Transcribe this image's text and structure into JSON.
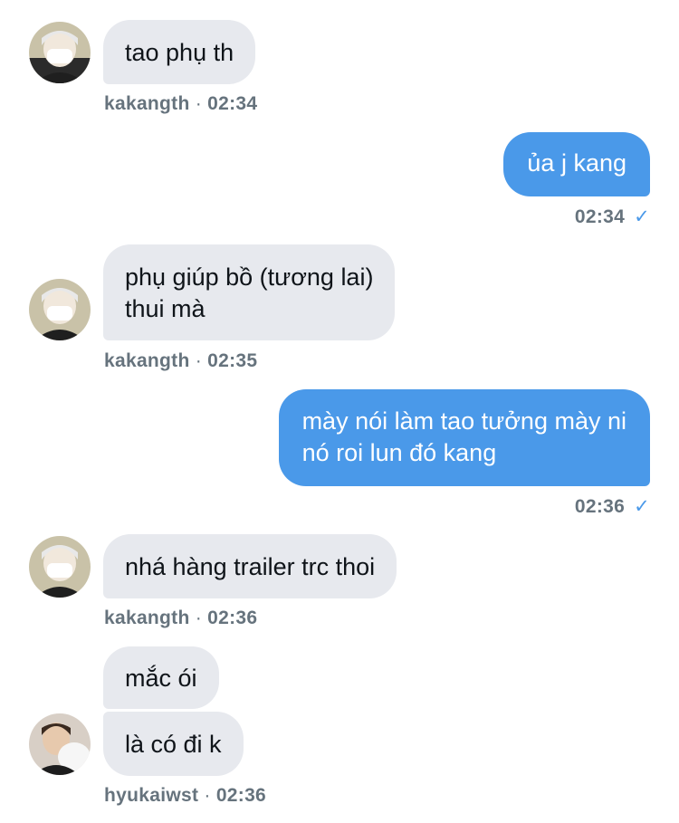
{
  "messages": [
    {
      "text": "tao phụ th",
      "sender": "kakangth",
      "time": "02:34"
    },
    {
      "text": "ủa j kang",
      "time": "02:34",
      "status": "✓"
    },
    {
      "text_lines": [
        "phụ giúp bồ (tương lai)",
        "thui mà"
      ],
      "sender": "kakangth",
      "time": "02:35"
    },
    {
      "text_lines": [
        "mày nói làm tao tưởng mày ni",
        "nó roi lun đó kang"
      ],
      "time": "02:36",
      "status": "✓"
    },
    {
      "text": "nhá hàng trailer trc thoi",
      "sender": "kakangth",
      "time": "02:36"
    },
    {
      "text": "mắc ói"
    },
    {
      "text": "là có đi k",
      "sender": "hyukaiwst",
      "time": "02:36"
    }
  ],
  "separator": "·",
  "colors": {
    "incoming_bubble": "#e7e9ee",
    "outgoing_bubble": "#4a99e9",
    "meta_text": "#66737d",
    "check": "#4a99e9"
  },
  "icons": {
    "read_receipt": "check-icon",
    "avatars": [
      "avatar-kakangth",
      "avatar-hyukaiwst"
    ]
  }
}
